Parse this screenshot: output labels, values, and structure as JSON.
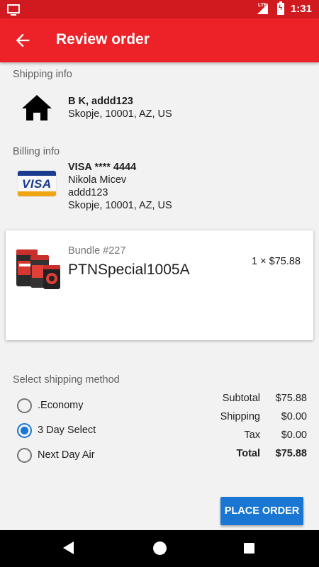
{
  "status_bar": {
    "network": "LTE",
    "time": "1:31"
  },
  "app_bar": {
    "title": "Review order"
  },
  "shipping_info": {
    "label": "Shipping info",
    "name": "B K, addd123",
    "address_line": "Skopje, 10001, AZ, US"
  },
  "billing_info": {
    "label": "Billing info",
    "card": "VISA **** 4444",
    "name": "Nikola Micev",
    "street": "addd123",
    "address_line": "Skopje, 10001, AZ, US",
    "card_logo_text": "VISA"
  },
  "order_item": {
    "bundle_label": "Bundle #227",
    "product_name": "PTNSpecial1005A",
    "quantity_price": "1 × $75.88"
  },
  "shipping_method": {
    "label": "Select shipping method",
    "options": [
      {
        "label": ".Economy",
        "selected": false
      },
      {
        "label": "3 Day Select",
        "selected": true
      },
      {
        "label": "Next Day Air",
        "selected": false
      }
    ]
  },
  "totals": {
    "subtotal_label": "Subtotal",
    "subtotal_value": "$75.88",
    "shipping_label": "Shipping",
    "shipping_value": "$0.00",
    "tax_label": "Tax",
    "tax_value": "$0.00",
    "total_label": "Total",
    "total_value": "$75.88"
  },
  "place_order_label": "Place order",
  "colors": {
    "status_bar": "#d11a1f",
    "app_bar": "#ed2229",
    "accent": "#1976d2"
  }
}
